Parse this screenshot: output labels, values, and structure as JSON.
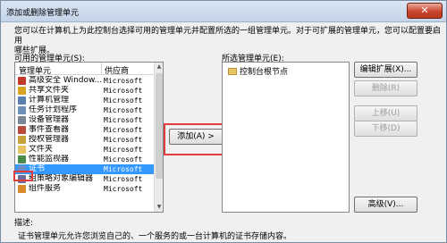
{
  "dialog": {
    "title": "添加或删除管理单元",
    "close_label": "✕",
    "intro_line1": "您可以在计算机上为此控制台选择可用的管理单元并配置所选的一组管理单元。对于可扩展的管理单元，您可以配置要启用",
    "intro_line2": "哪些扩展。"
  },
  "available": {
    "label": "可用的管理单元(S):",
    "col_name": "管理单元",
    "col_vendor": "供应商",
    "items": [
      {
        "name": "高级安全 Window...",
        "vendor": "Microsoft",
        "icon": "firewall-icon",
        "color": "#c0392b"
      },
      {
        "name": "共享文件夹",
        "vendor": "Microsoft",
        "icon": "shared-folder-icon",
        "color": "#d9a521"
      },
      {
        "name": "计算机管理",
        "vendor": "Microsoft",
        "icon": "computer-management-icon",
        "color": "#5a7fb0"
      },
      {
        "name": "任务计划程序",
        "vendor": "Microsoft",
        "icon": "task-scheduler-icon",
        "color": "#6d8fb8"
      },
      {
        "name": "设备管理器",
        "vendor": "Microsoft",
        "icon": "device-manager-icon",
        "color": "#7b8796"
      },
      {
        "name": "事件查看器",
        "vendor": "Microsoft",
        "icon": "event-viewer-icon",
        "color": "#b84a3a"
      },
      {
        "name": "授权管理器",
        "vendor": "Microsoft",
        "icon": "authorization-manager-icon",
        "color": "#c9a13a"
      },
      {
        "name": "文件夹",
        "vendor": "Microsoft",
        "icon": "folder-icon",
        "color": "#e7c45f"
      },
      {
        "name": "性能监视器",
        "vendor": "Microsoft",
        "icon": "performance-monitor-icon",
        "color": "#4a8a4a"
      },
      {
        "name": "证书",
        "vendor": "Microsoft",
        "icon": "certificate-icon",
        "color": "#6a8fc4"
      },
      {
        "name": "组策略对象编辑器",
        "vendor": "Microsoft",
        "icon": "group-policy-icon",
        "color": "#6b6b9a"
      },
      {
        "name": "组件服务",
        "vendor": "Microsoft",
        "icon": "component-services-icon",
        "color": "#d88a2a"
      }
    ],
    "selected_index": 9
  },
  "add_button": "添加(A) >",
  "selected": {
    "label": "所选管理单元(E):",
    "items": [
      "控制台根节点"
    ]
  },
  "right_buttons": {
    "edit_extensions": "编辑扩展(X)...",
    "remove": "删除(R)",
    "move_up": "上移(U)",
    "move_down": "下移(D)",
    "advanced": "高级(V)..."
  },
  "description": {
    "label": "描述:",
    "text": "证书管理单元允许您浏览自己的、一个服务的或一台计算机的证书存储内容。"
  },
  "colors": {
    "highlight": "#3399ff",
    "annotation": "#e23b3b"
  }
}
